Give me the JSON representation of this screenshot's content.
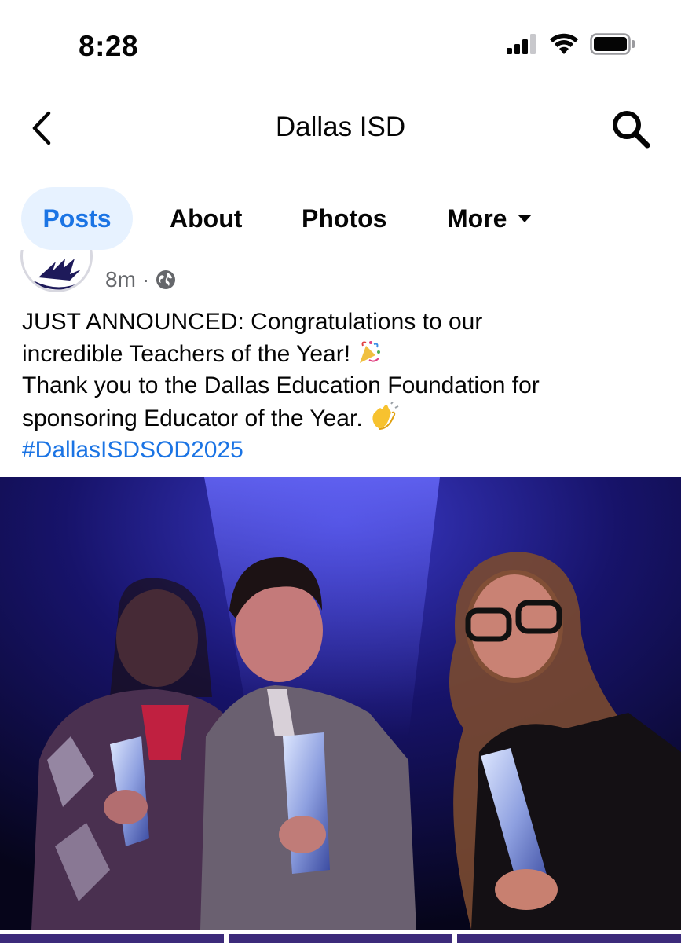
{
  "status_bar": {
    "time": "8:28"
  },
  "nav": {
    "title": "Dallas ISD"
  },
  "tabs": [
    {
      "label": "Posts",
      "active": true
    },
    {
      "label": "About",
      "active": false
    },
    {
      "label": "Photos",
      "active": false
    },
    {
      "label": "More",
      "active": false
    }
  ],
  "post": {
    "timestamp": "8m",
    "separator": "·",
    "text_line_1": "JUST ANNOUNCED: Congratulations to our",
    "text_line_2": "incredible Teachers of the Year!",
    "text_line_3": "Thank you to the Dallas Education Foundation for",
    "text_line_4": "sponsoring Educator of the Year.",
    "hashtag": "#DallasISDSOD2025",
    "photo_icon": "photo-three-teachers-holding-trophies"
  },
  "colors": {
    "accent": "#1b74e4",
    "active_tab_bg": "#e7f2ff",
    "meta_gray": "#65676b",
    "thumb_purple": "#3c2a7a"
  }
}
